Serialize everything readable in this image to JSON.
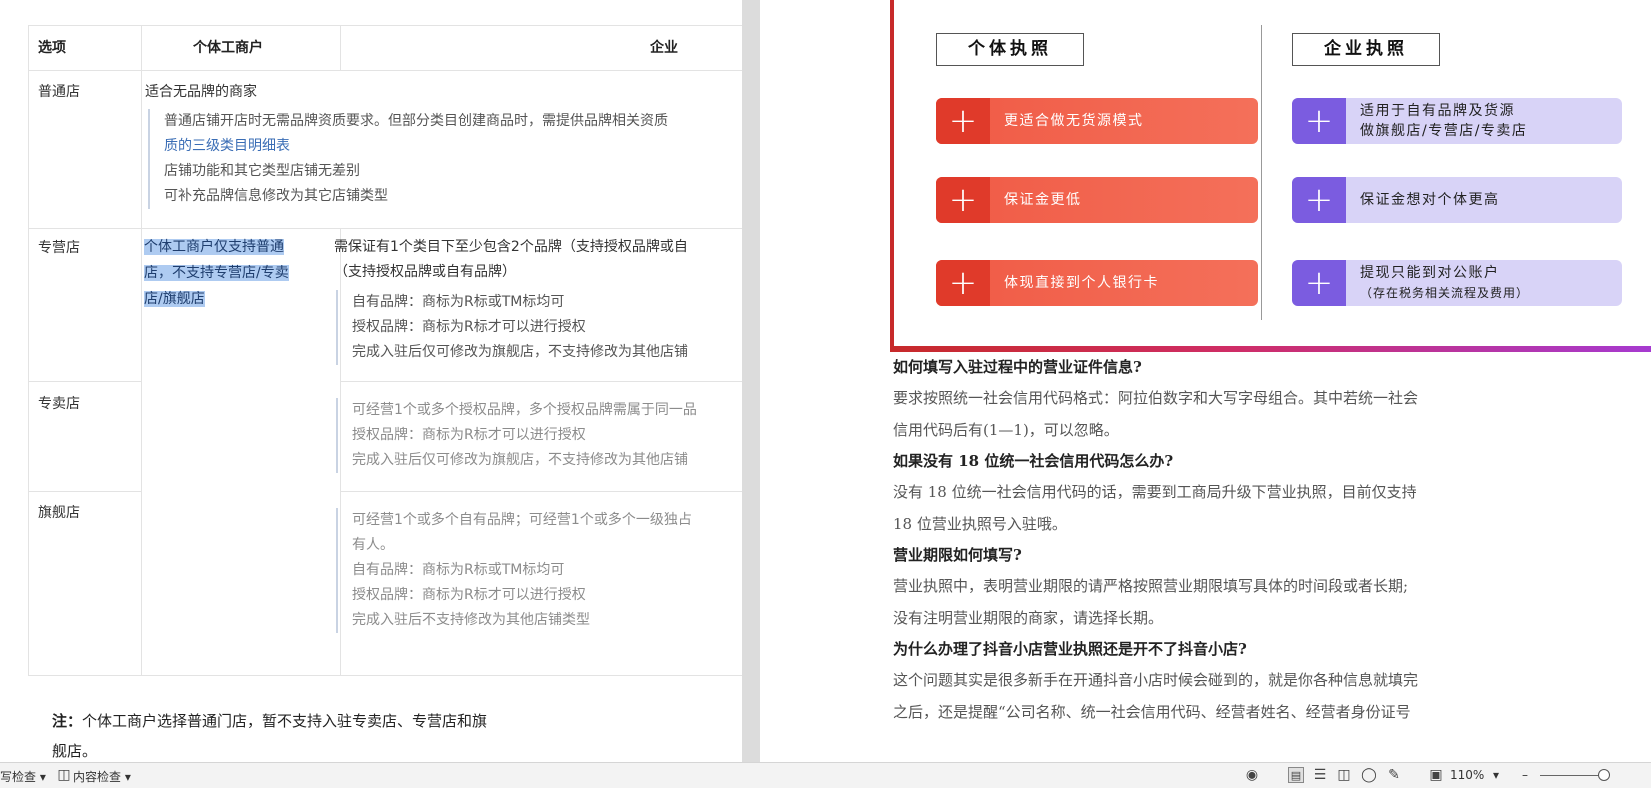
{
  "table": {
    "headers": [
      "选项",
      "个体工商户",
      "企业"
    ],
    "rows": {
      "normal": {
        "label": "普通店",
        "summary": "适合无品牌的商家",
        "details": [
          "普通店铺开店时无需品牌资质要求。但部分类目创建商品时，需提供品牌相关资质",
          "质的三级类目明细表",
          "店铺功能和其它类型店铺无差别",
          "可补充品牌信息修改为其它店铺类型"
        ]
      },
      "specialty": {
        "label": "专营店",
        "individual_note": [
          "个体工商户仅支持普通",
          "店，不支持专营店/专卖",
          "店/旗舰店"
        ],
        "summary": [
          "需保证有1个类目下至少包含2个品牌（支持授权品牌或自",
          "（支持授权品牌或自有品牌）"
        ],
        "details": [
          "自有品牌：商标为R标或TM标均可",
          "授权品牌：商标为R标才可以进行授权",
          "完成入驻后仅可修改为旗舰店，不支持修改为其他店铺"
        ]
      },
      "exclusive": {
        "label": "专卖店",
        "details": [
          "可经营1个或多个授权品牌，多个授权品牌需属于同一品",
          "授权品牌：商标为R标才可以进行授权",
          "完成入驻后仅可修改为旗舰店，不支持修改为其他店铺"
        ]
      },
      "flagship": {
        "label": "旗舰店",
        "details": [
          "可经营1个或多个自有品牌；可经营1个或多个一级独占",
          "有人。",
          "自有品牌：商标为R标或TM标均可",
          "授权品牌：商标为R标才可以进行授权",
          "完成入驻后不支持修改为其他店铺类型"
        ]
      }
    }
  },
  "note": {
    "label": "注：",
    "text": "个体工商户选择普通门店，暂不支持入驻专卖店、专营店和旗",
    "text2": "舰店。"
  },
  "banner": {
    "left_title": "个体执照",
    "right_title": "企业执照",
    "left_items": [
      "更适合做无货源模式",
      "保证金更低",
      "体现直接到个人银行卡"
    ],
    "right_items": [
      {
        "line1": "适用于自有品牌及货源",
        "line2": "做旗舰店/专营店/专卖店"
      },
      {
        "line1": "保证金想对个体更高",
        "line2": ""
      },
      {
        "line1": "提现只能到对公账户",
        "line2": "（存在税务相关流程及费用）"
      }
    ],
    "plus_glyph": "+"
  },
  "article": {
    "q1": "如何填写入驻过程中的营业证件信息?",
    "a1": [
      "要求按照统一社会信用代码格式：阿拉伯数字和大写字母组合。其中若统一社会",
      "信用代码后有(1—1)，可以忽略。"
    ],
    "q2": "如果没有 18 位统一社会信用代码怎么办?",
    "a2": [
      "没有 18 位统一社会信用代码的话，需要到工商局升级下营业执照，目前仅支持",
      "18 位营业执照号入驻哦。"
    ],
    "q3": "营业期限如何填写?",
    "a3": [
      "营业执照中，表明营业期限的请严格按照营业期限填写具体的时间段或者长期;",
      "没有注明营业期限的商家，请选择长期。"
    ],
    "q4": "为什么办理了抖音小店营业执照还是开不了抖音小店?",
    "a4": [
      "这个问题其实是很多新手在开通抖音小店时候会碰到的，就是你各种信息就填完",
      "之后，还是提醒“公司名称、统一社会信用代码、经营者姓名、经营者身份证号"
    ]
  },
  "statusbar": {
    "spell_check": "写检查 ▾",
    "content_check": "内容检查 ▾",
    "zoom": "110%",
    "zoom_dropdown": "▾",
    "zoom_minus": "–"
  }
}
